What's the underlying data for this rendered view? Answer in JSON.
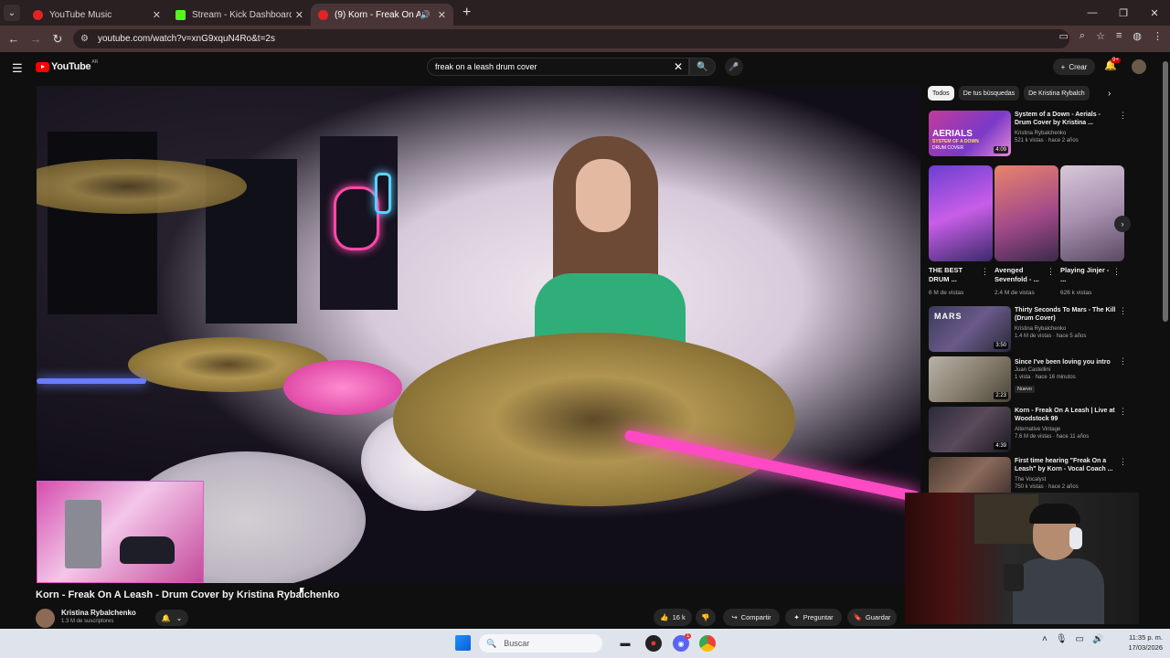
{
  "browser": {
    "tabs": [
      {
        "title": "YouTube Music",
        "favicon_color": "#e02424"
      },
      {
        "title": "Stream - Kick Dashboard",
        "favicon_color": "#53fc18"
      },
      {
        "title": "(9) Korn - Freak On A Leash",
        "favicon_color": "#e02424"
      }
    ],
    "url": "youtube.com/watch?v=xnG9xquN4Ro&t=2s"
  },
  "youtube": {
    "logo_text": "YouTube",
    "logo_region": "AR",
    "search_value": "freak on a leash drum cover",
    "create_label": "Crear",
    "notification_count": "9+"
  },
  "video": {
    "title": "Korn - Freak On A Leash - Drum Cover by Kristina Rybalchenko",
    "channel": "Kristina Rybalchenko",
    "subscribers": "1.3 M de suscriptores",
    "likes": "16 k",
    "share_label": "Compartir",
    "ask_label": "Preguntar",
    "save_label": "Guardar"
  },
  "filter_chips": [
    "Todos",
    "De tus búsquedas",
    "De Kristina Rybalch"
  ],
  "recommendations": [
    {
      "title": "System of a Down - Aerials - Drum Cover by Kristina ...",
      "channel": "Kristina Rybalchenko",
      "meta": "521 k vistas · hace 2 años",
      "duration": "4:09",
      "thumb_label": "AERIALS",
      "thumb_sub": "SYSTEM OF A DOWN",
      "thumb_sub2": "DRUM COVER"
    },
    {
      "title": "Thirty Seconds To Mars - The Kill (Drum Cover)",
      "channel": "Kristina Rybalchenko",
      "meta": "1.4 M de vistas · hace 5 años",
      "duration": "3:50",
      "thumb_label": "MARS"
    },
    {
      "title": "Since I've been loving you intro",
      "channel": "Juan Castellini",
      "meta": "1 vista · hace 16 minutos",
      "duration": "2:23",
      "badge": "Nuevo"
    },
    {
      "title": "Korn - Freak On A Leash | Live at Woodstock 99",
      "channel": "Alternative Vintage",
      "meta": "7.6 M de vistas · hace 11 años",
      "duration": "4:39"
    },
    {
      "title": "First time hearing \"Freak On a Leash\" by Korn - Vocal Coach ...",
      "channel": "The Vocalyst",
      "meta": "750 k vistas · hace 2 años"
    }
  ],
  "shorts": [
    {
      "title": "THE BEST DRUM ...",
      "views": "6 M de vistas"
    },
    {
      "title": "Avenged Sevenfold - ...",
      "views": "2.4 M de vistas"
    },
    {
      "title": "Playing Jinjer - ...",
      "views": "626 k vistas"
    }
  ],
  "taskbar": {
    "search_placeholder": "Buscar",
    "time": "11:35 p. m.",
    "date": "17/03/2026",
    "discord_badge": "1"
  }
}
